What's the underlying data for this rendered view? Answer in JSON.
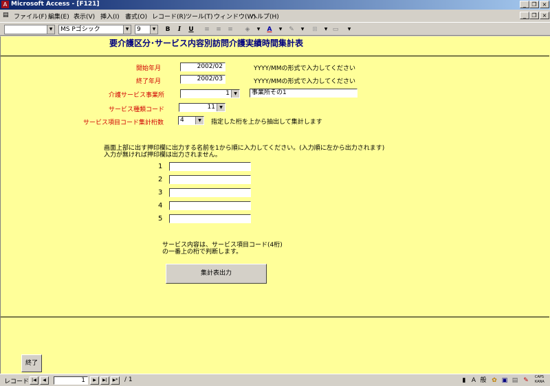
{
  "window": {
    "title": "Microsoft Access - [F121]"
  },
  "menu": [
    "ファイル(F)",
    "編集(E)",
    "表示(V)",
    "挿入(I)",
    "書式(O)",
    "レコード(R)",
    "ツール(T)",
    "ウィンドウ(W)",
    "ヘルプ(H)"
  ],
  "toolbar": {
    "font_name": "MS Pゴシック",
    "font_size": "9",
    "bold": "B",
    "italic": "I",
    "underline": "U",
    "font_color_glyph": "A"
  },
  "form": {
    "title": "要介護区分･サービス内容別訪問介護実績時間集計表",
    "start_label": "開始年月",
    "start_value": "2002/02",
    "start_hint": "YYYY/MMの形式で入力してください",
    "end_label": "終了年月",
    "end_value": "2002/03",
    "end_hint": "YYYY/MMの形式で入力してください",
    "office_label": "介護サービス事業所",
    "office_value": "1",
    "office_name": "事業所その1",
    "type_label": "サービス種類コード",
    "type_value": "11",
    "digits_label": "サービス項目コード集計桁数",
    "digits_value": "4",
    "digits_hint": "指定した桁を上から抽出して集計します",
    "stamp_instruction_1": "画面上部に出す押印欄に出力する名前を1から順に入力してください。(入力順に左から出力されます)",
    "stamp_instruction_2": "入力が無ければ押印欄は出力されません。",
    "stamp_numbers": [
      "1",
      "2",
      "3",
      "4",
      "5"
    ],
    "stamp_values": [
      "",
      "",
      "",
      "",
      ""
    ],
    "service_note_1": "サービス内容は、サービス項目コード(4桁)",
    "service_note_2": "の一番上の桁で判断します。",
    "output_button": "集計表出力",
    "exit_button": "終了"
  },
  "status": {
    "record_label": "レコード:",
    "record_current": "1",
    "record_total": "/ 1",
    "caps": "CAPS",
    "kana": "KANA",
    "ime_mode": "般"
  }
}
